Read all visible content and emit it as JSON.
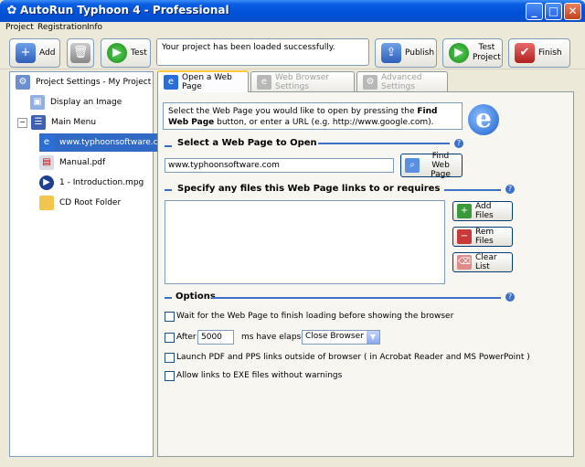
{
  "window": {
    "title": "AutoRun Typhoon 4 - Professional",
    "minimize": "_",
    "maximize": "□",
    "close": "✕"
  },
  "menu": {
    "items": [
      "Project",
      "Registration",
      "Info"
    ]
  },
  "toolbar": {
    "add_label": "Add",
    "test_label": "Test",
    "status_text": "Your project  has been loaded  successfully.",
    "publish_label": "Publish",
    "test_project_label": "Test\nProject",
    "finish_label": "Finish"
  },
  "tree": {
    "root": "Project Settings - My Project",
    "display_image": "Display an Image",
    "main_menu": "Main Menu",
    "website": "www.typhoonsoftware.com",
    "manual": "Manual.pdf",
    "video": "1 - Introduction.mpg",
    "cd_root": "CD Root Folder"
  },
  "tabs": {
    "open_web_page": "Open a Web Page",
    "browser_settings": "Web Browser Settings",
    "advanced_settings": "Advanced Settings"
  },
  "web_page_tab": {
    "info_part1": "Select the Web Page you would like to open by pressing the ",
    "info_bold": "Find Web Page",
    "info_part2": " button, or enter a URL (e.g. http://www.google.com).",
    "section_select": "Select a Web Page to Open",
    "url_value": "www.typhoonsoftware.com",
    "find_web_page_label": "Find Web Page",
    "section_links": "Specify any files this Web Page links to or requires",
    "add_files_label": "Add Files",
    "rem_files_label": "Rem Files",
    "clear_list_label": "Clear List",
    "section_options": "Options",
    "opt_wait": "Wait for the Web Page to finish loading before showing the browser",
    "opt_after_label": "After",
    "opt_after_value": "5000",
    "opt_ms_elapsed": "ms have elapsed",
    "opt_browser_action": "Close Browser",
    "opt_launch_pdf": "Launch PDF and PPS links outside of browser ( in Acrobat Reader and MS PowerPoint )",
    "opt_allow_exe": "Allow links to EXE files without warnings"
  },
  "colors": {
    "titlebar": "#0054e3",
    "selection": "#316ac5",
    "section_line": "#3d71c7"
  }
}
